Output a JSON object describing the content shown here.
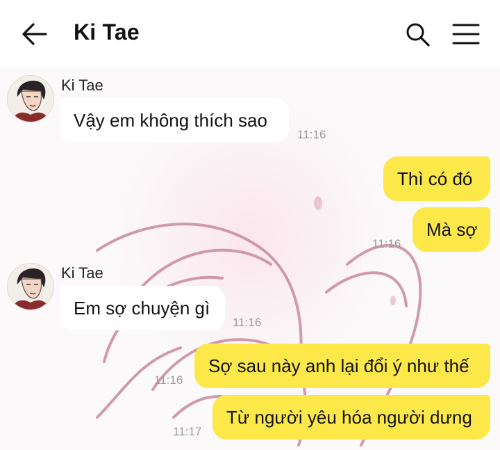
{
  "header": {
    "title": "Ki Tae",
    "back_icon": "arrow-left-icon",
    "search_icon": "search-icon",
    "menu_icon": "hamburger-menu-icon"
  },
  "messages": [
    {
      "sender": "Ki Tae",
      "direction": "in",
      "text": "Vậy em không thích sao",
      "time": "11:16"
    },
    {
      "direction": "out",
      "text": "Thì có đó"
    },
    {
      "direction": "out",
      "text": "Mà sợ",
      "time": "11:16"
    },
    {
      "sender": "Ki Tae",
      "direction": "in",
      "text": "Em sợ chuyện gì",
      "time": "11:16"
    },
    {
      "direction": "out",
      "text": "Sợ sau này anh lại đổi ý như thế",
      "time": "11:16"
    },
    {
      "direction": "out",
      "text": "Từ người yêu hóa người dưng",
      "time": "11:17"
    }
  ],
  "colors": {
    "outgoing_bubble": "#fde84a",
    "incoming_bubble": "#ffffff",
    "header_bg": "#ffffff",
    "timestamp": "#9a9a9a",
    "wallpaper_line": "#c98aa0"
  }
}
